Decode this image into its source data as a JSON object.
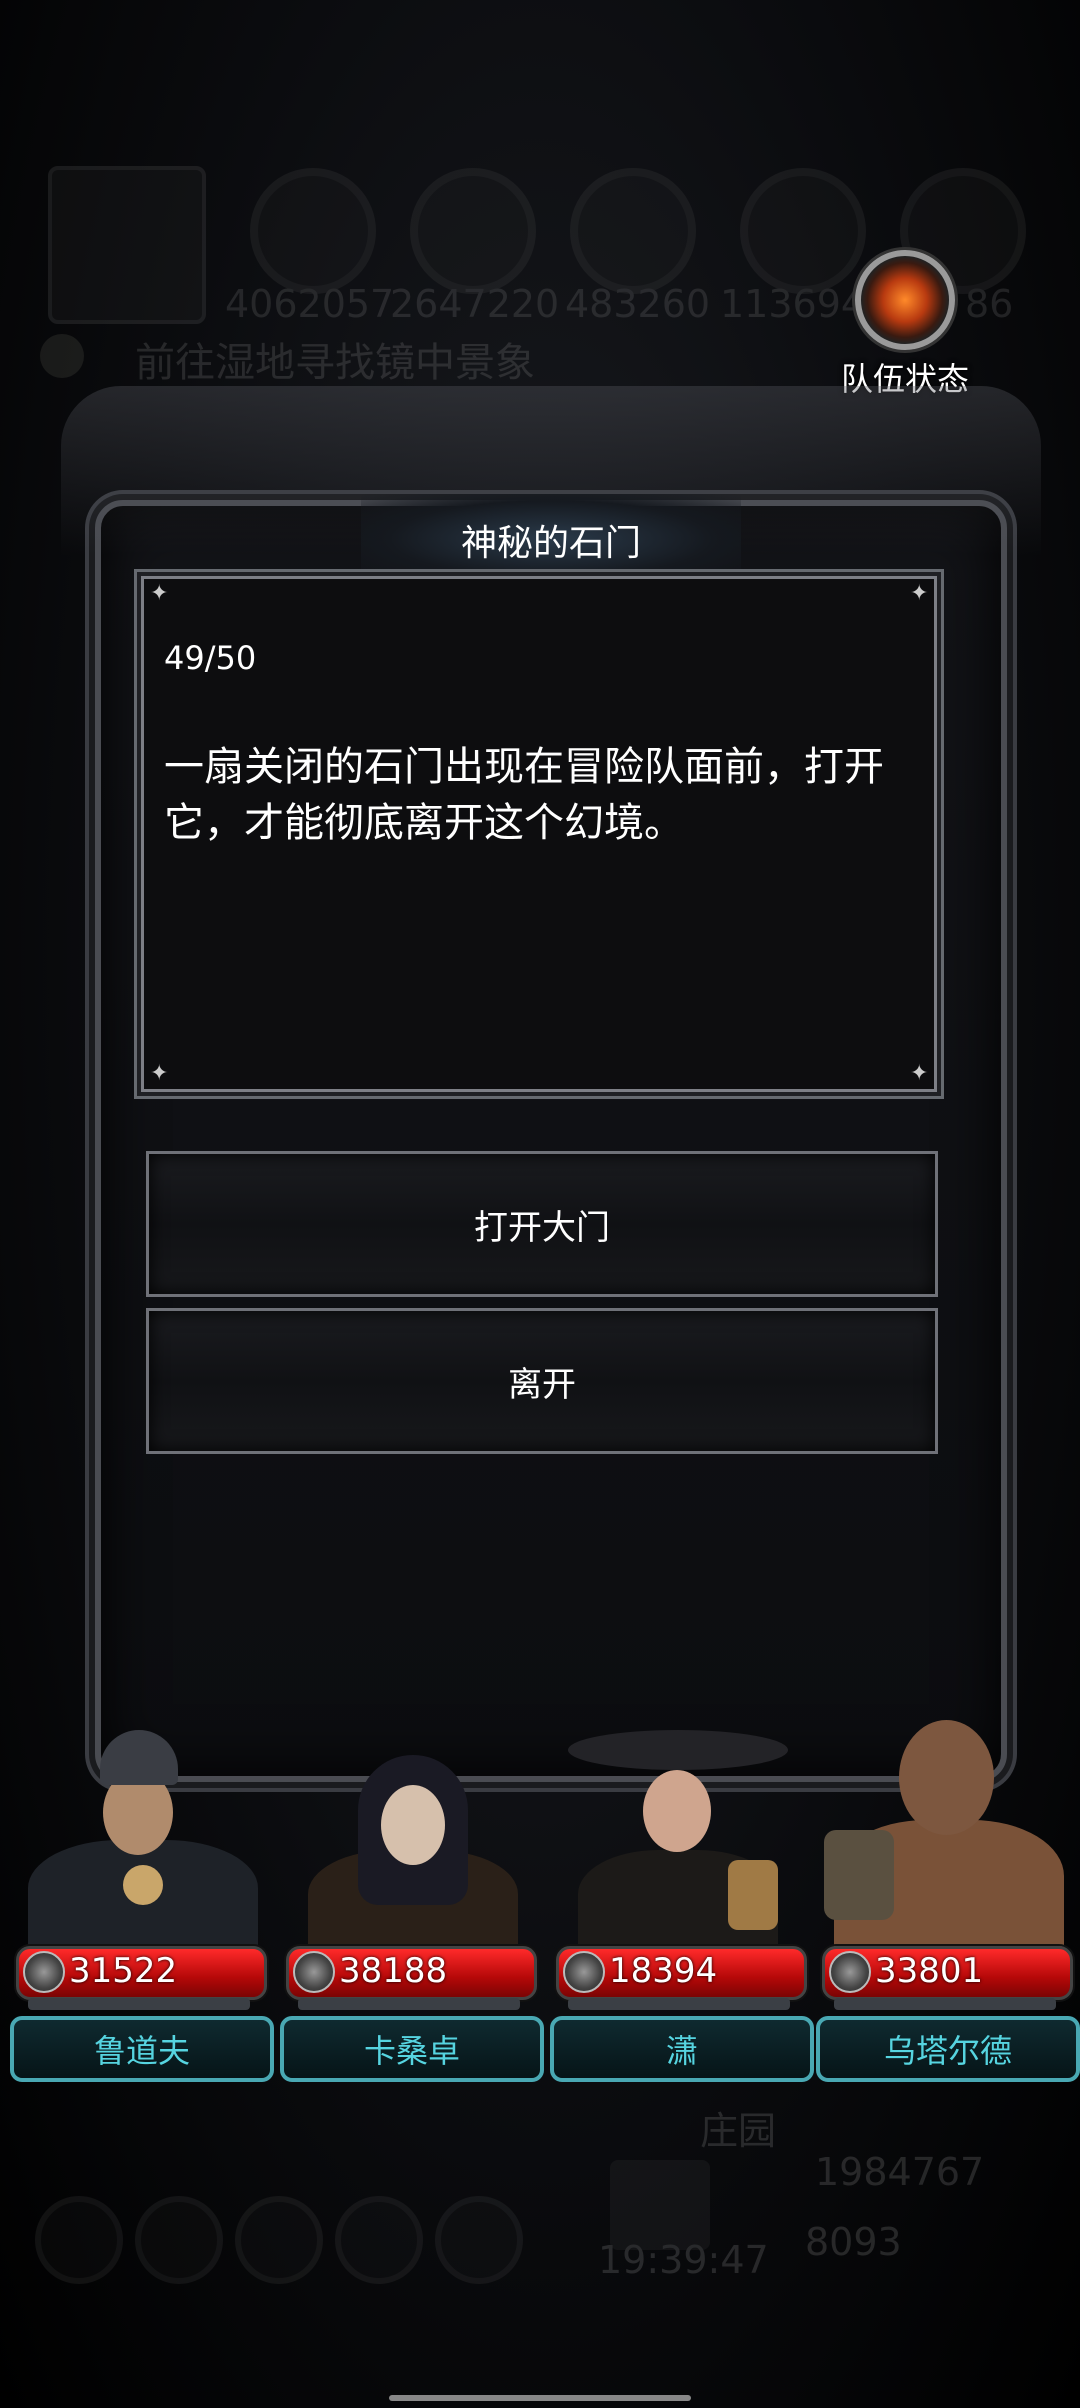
{
  "background_hud": {
    "resources": [
      "4062057",
      "2647220",
      "483260",
      "1136947",
      "86"
    ],
    "quest": "前往湿地寻找镜中景象",
    "estate": "庄园",
    "gold": "1984767",
    "gem": "8093",
    "clock": "19:39:47"
  },
  "team_status": {
    "label": "队伍状态",
    "icon": "fire-emblem-icon"
  },
  "dialog": {
    "title": "神秘的石门",
    "counter": "49/50",
    "story": "一扇关闭的石门出现在冒险队面前，打开它，才能彻底离开这个幻境。",
    "choices": [
      {
        "label": "打开大门"
      },
      {
        "label": "离开"
      }
    ]
  },
  "party": [
    {
      "name": "鲁道夫",
      "hp": "31522"
    },
    {
      "name": "卡桑卓",
      "hp": "38188"
    },
    {
      "name": "潇",
      "hp": "18394"
    },
    {
      "name": "乌塔尔德",
      "hp": "33801"
    }
  ]
}
